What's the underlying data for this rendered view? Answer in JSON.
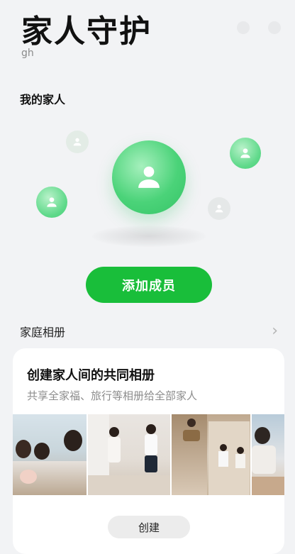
{
  "page": {
    "title": "家人守护",
    "subtitle": "gh"
  },
  "family": {
    "section_label": "我的家人",
    "add_member_label": "添加成员"
  },
  "album": {
    "row_label": "家庭相册",
    "card_title": "创建家人间的共同相册",
    "card_description": "共享全家福、旅行等相册给全部家人",
    "create_label": "创建",
    "photos": [
      "family-piggybank-photo",
      "kids-playing-photo",
      "stairs-family-photo",
      "grandparent-photo"
    ]
  },
  "icons": [
    "person-icon",
    "chevron-right-icon"
  ],
  "colors": {
    "accent_green": "#19be3a",
    "bubble_green": "#4bd379",
    "background": "#f2f3f5"
  }
}
